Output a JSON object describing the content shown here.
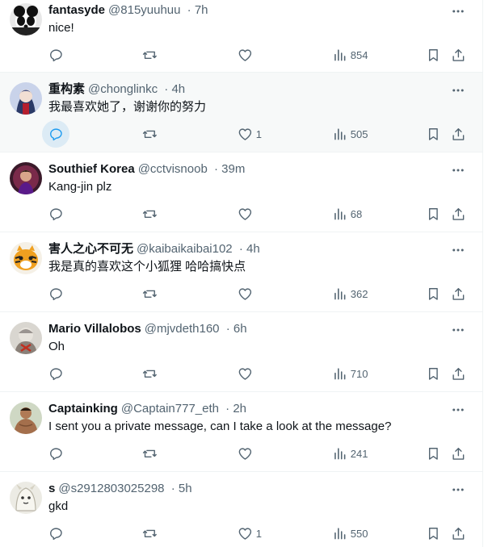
{
  "replies": [
    {
      "name": "fantasyde",
      "handle": "@815yuuhuu",
      "time": "7h",
      "text": "nice!",
      "replies": "",
      "reposts": "",
      "likes": "",
      "views": "854",
      "highlight": false
    },
    {
      "name": "重构素",
      "handle": "@chonglinkc",
      "time": "4h",
      "text": "我最喜欢她了，谢谢你的努力",
      "replies": "",
      "reposts": "",
      "likes": "1",
      "views": "505",
      "highlight": true
    },
    {
      "name": "Southief Korea",
      "handle": "@cctvisnoob",
      "time": "39m",
      "text": "Kang-jin plz",
      "replies": "",
      "reposts": "",
      "likes": "",
      "views": "68",
      "highlight": false
    },
    {
      "name": "害人之心不可无",
      "handle": "@kaibaikaibai102",
      "time": "4h",
      "text": "我是真的喜欢这个小狐狸 哈哈搞快点",
      "replies": "",
      "reposts": "",
      "likes": "",
      "views": "362",
      "highlight": false
    },
    {
      "name": "Mario Villalobos",
      "handle": "@mjvdeth160",
      "time": "6h",
      "text": "Oh",
      "replies": "",
      "reposts": "",
      "likes": "",
      "views": "710",
      "highlight": false
    },
    {
      "name": "Captainking",
      "handle": "@Captain777_eth",
      "time": "2h",
      "text": "I sent you a private message, can I take a look at the message?",
      "replies": "",
      "reposts": "",
      "likes": "",
      "views": "241",
      "highlight": false
    },
    {
      "name": "s",
      "handle": "@s2912803025298",
      "time": "5h",
      "text": "gkd",
      "replies": "",
      "reposts": "",
      "likes": "1",
      "views": "550",
      "highlight": false
    }
  ],
  "colors": {
    "muted": "#536471",
    "text": "#0f1419",
    "accent": "#1d9bf0",
    "border": "#eff3f4"
  },
  "icons": {
    "reply": "reply-icon",
    "repost": "repost-icon",
    "like": "like-icon",
    "views": "views-icon",
    "share": "share-icon",
    "bookmark": "bookmark-icon",
    "more": "more-icon"
  }
}
